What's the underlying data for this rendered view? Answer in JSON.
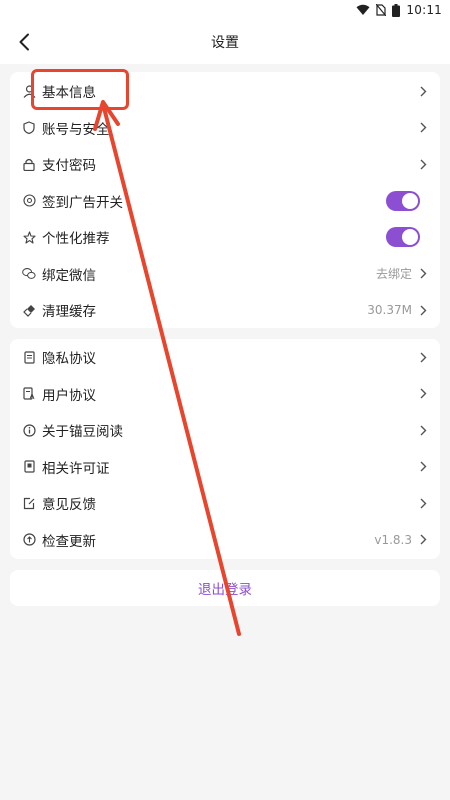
{
  "status_bar": {
    "time": "10:11",
    "icons": [
      "wifi-icon",
      "no-sim-icon",
      "battery-icon"
    ]
  },
  "header": {
    "title": "设置",
    "back_icon": "back-arrow-icon"
  },
  "section1": {
    "items": [
      {
        "label": "基本信息",
        "icon": "user-icon"
      },
      {
        "label": "账号与安全",
        "icon": "shield-icon"
      },
      {
        "label": "支付密码",
        "icon": "lock-icon"
      },
      {
        "label": "签到广告开关",
        "icon": "ad-icon",
        "toggle": true
      },
      {
        "label": "个性化推荐",
        "icon": "star-icon",
        "toggle": true
      },
      {
        "label": "绑定微信",
        "icon": "wechat-icon",
        "value": "去绑定"
      },
      {
        "label": "清理缓存",
        "icon": "broom-icon",
        "value": "30.37M"
      }
    ]
  },
  "section2": {
    "items": [
      {
        "label": "隐私协议",
        "icon": "document-icon"
      },
      {
        "label": "用户协议",
        "icon": "document-a-icon"
      },
      {
        "label": "关于锚豆阅读",
        "icon": "info-icon"
      },
      {
        "label": "相关许可证",
        "icon": "license-icon"
      },
      {
        "label": "意见反馈",
        "icon": "edit-icon"
      },
      {
        "label": "检查更新",
        "icon": "update-icon",
        "value": "v1.8.3"
      }
    ]
  },
  "logout_label": "退出登录",
  "colors": {
    "accent": "#8c4fd2",
    "annotation": "#e8452e",
    "background": "#f5f5f5"
  }
}
